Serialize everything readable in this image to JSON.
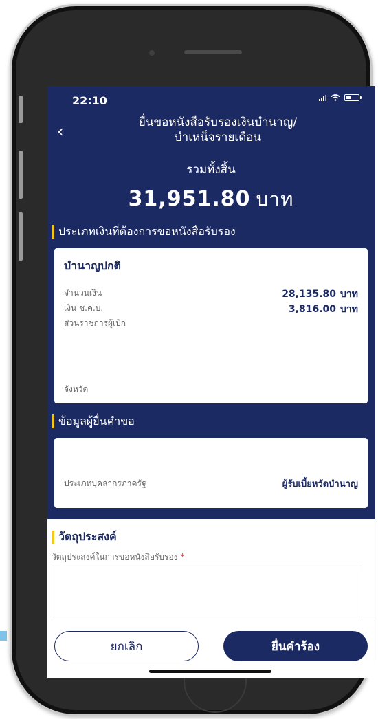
{
  "status_bar": {
    "time": "22:10"
  },
  "header": {
    "back_icon": "chevron-left-icon",
    "title": "ยื่นขอหนังสือรับรองเงินบำนาญ/\nบำเหน็จรายเดือน"
  },
  "summary": {
    "label": "รวมทั้งสิ้น",
    "amount": "31,951.80",
    "unit": "บาท"
  },
  "section_requested": {
    "heading": "ประเภทเงินที่ต้องการขอหนังสือรับรอง",
    "card": {
      "title": "บำนาญปกติ",
      "rows": [
        {
          "label": "จำนวนเงิน",
          "value": "28,135.80",
          "unit": "บาท"
        },
        {
          "label": "เงิน ช.ค.บ.",
          "value": "3,816.00",
          "unit": "บาท"
        },
        {
          "label": "ส่วนราชการผู้เบิก",
          "value": ""
        },
        {
          "label": "จังหวัด",
          "value": ""
        }
      ]
    }
  },
  "section_applicant": {
    "heading": "ข้อมูลผู้ยื่นคำขอ",
    "row": {
      "label": "ประเภทบุคลากรภาครัฐ",
      "value": "ผู้รับเบี้ยหวัดบำนาญ"
    }
  },
  "section_purpose": {
    "heading": "วัตถุประสงค์",
    "field_label": "วัตถุประสงค์ในการขอหนังสือรับรอง",
    "required_mark": "*",
    "value": ""
  },
  "buttons": {
    "cancel": "ยกเลิก",
    "submit": "ยื่นคำร้อง"
  },
  "colors": {
    "primary": "#1c2a64",
    "accent": "#f5c518"
  }
}
